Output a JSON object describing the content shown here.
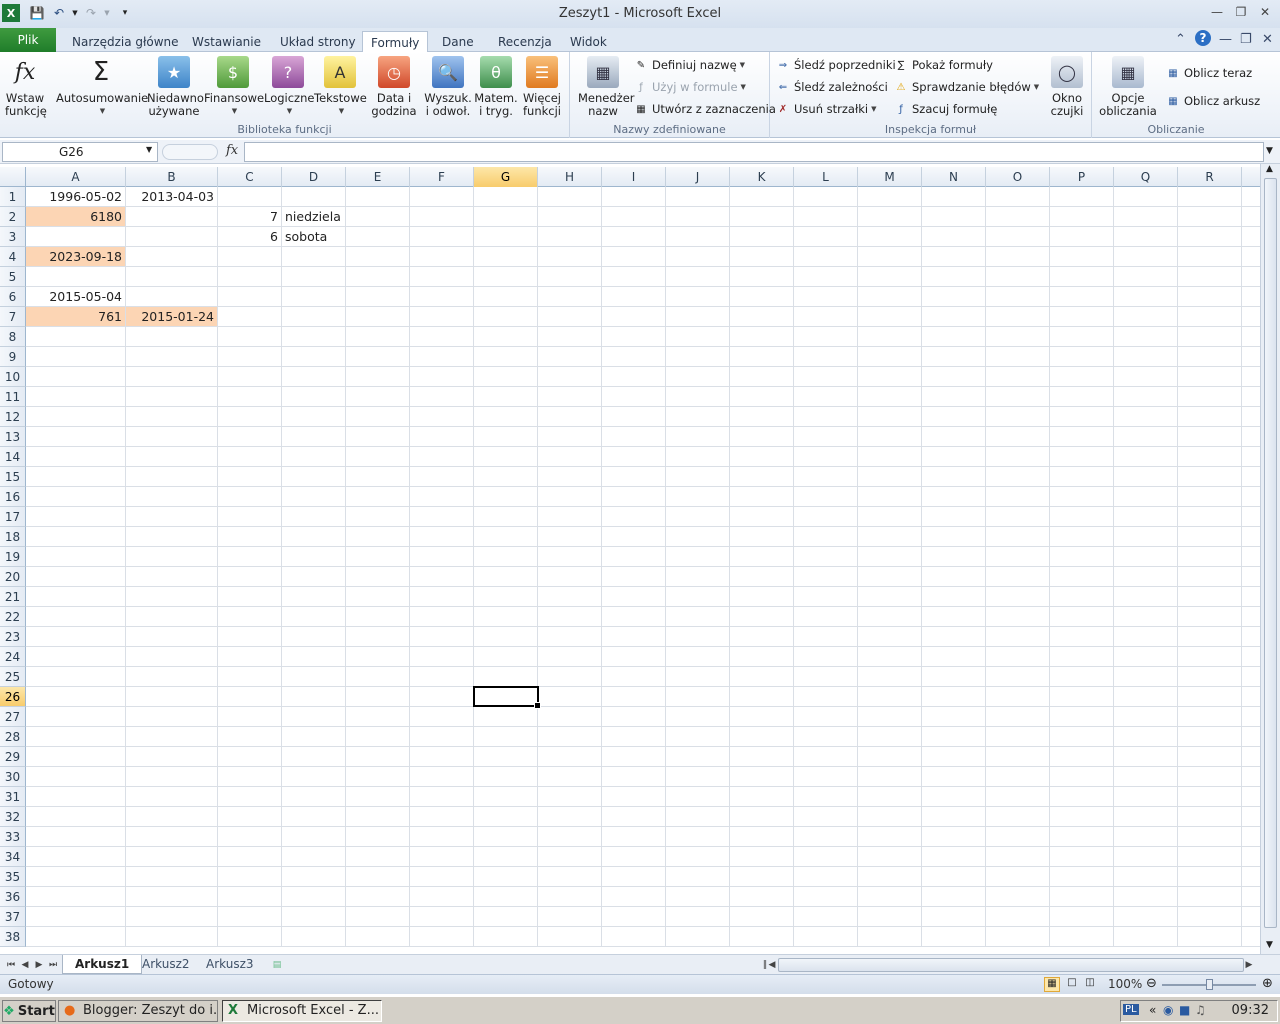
{
  "window": {
    "title": "Zeszyt1  -  Microsoft Excel"
  },
  "ribbon_tabs": [
    "Plik",
    "Narzędzia główne",
    "Wstawianie",
    "Układ strony",
    "Formuły",
    "Dane",
    "Recenzja",
    "Widok"
  ],
  "active_tab": "Formuły",
  "groups": {
    "biblioteka": {
      "label": "Biblioteka funkcji",
      "insert_function": "Wstaw funkcję",
      "autosum": "Autosumowanie",
      "recent": "Niedawno używane",
      "financial": "Finansowe",
      "logical": "Logiczne",
      "text": "Tekstowe",
      "datetime": "Data i godzina",
      "lookup": "Wyszuk. i odwoł.",
      "math": "Matem. i tryg.",
      "more": "Więcej funkcji"
    },
    "nazwy": {
      "label": "Nazwy zdefiniowane",
      "manager": "Menedżer nazw",
      "define": "Definiuj nazwę",
      "use": "Użyj w formule",
      "create": "Utwórz z zaznaczenia"
    },
    "inspekcja": {
      "label": "Inspekcja formuł",
      "precedents": "Śledź poprzedniki",
      "dependents": "Śledź zależności",
      "remove": "Usuń strzałki",
      "show": "Pokaż formuły",
      "errors": "Sprawdzanie błędów",
      "evaluate": "Szacuj formułę",
      "watch": "Okno czujki"
    },
    "obliczanie": {
      "label": "Obliczanie",
      "options": "Opcje obliczania",
      "calc_now": "Oblicz teraz",
      "calc_sheet": "Oblicz arkusz"
    }
  },
  "formula_bar": {
    "name_box": "G26",
    "fx": "fx",
    "value": ""
  },
  "columns": [
    "A",
    "B",
    "C",
    "D",
    "E",
    "F",
    "G",
    "H",
    "I",
    "J",
    "K",
    "L",
    "M",
    "N",
    "O",
    "P",
    "Q",
    "R"
  ],
  "selected_column": "G",
  "rows": [
    "1",
    "2",
    "3",
    "4",
    "5",
    "6",
    "7",
    "8",
    "9",
    "10",
    "11",
    "12",
    "13",
    "14",
    "15",
    "16",
    "17",
    "18",
    "19",
    "20",
    "21",
    "22",
    "23",
    "24",
    "25",
    "26",
    "27",
    "28",
    "29",
    "30",
    "31",
    "32",
    "33",
    "34",
    "35",
    "36",
    "37",
    "38"
  ],
  "selected_row": "26",
  "cells": [
    {
      "ref": "A1",
      "value": "1996-05-02",
      "highlight": false
    },
    {
      "ref": "B1",
      "value": "2013-04-03",
      "highlight": false
    },
    {
      "ref": "A2",
      "value": "6180",
      "highlight": true
    },
    {
      "ref": "C2",
      "value": "7",
      "highlight": false
    },
    {
      "ref": "D2",
      "value": "niedziela",
      "highlight": false,
      "align": "left"
    },
    {
      "ref": "C3",
      "value": "6",
      "highlight": false
    },
    {
      "ref": "D3",
      "value": "sobota",
      "highlight": false,
      "align": "left"
    },
    {
      "ref": "A4",
      "value": "2023-09-18",
      "highlight": true
    },
    {
      "ref": "A6",
      "value": "2015-05-04",
      "highlight": false
    },
    {
      "ref": "A7",
      "value": "761",
      "highlight": true
    },
    {
      "ref": "B7",
      "value": "2015-01-24",
      "highlight": true
    }
  ],
  "highlight_color": "#fcd5b4",
  "sheets": [
    "Arkusz1",
    "Arkusz2",
    "Arkusz3"
  ],
  "active_sheet": "Arkusz1",
  "status": {
    "text": "Gotowy",
    "zoom": "100%"
  },
  "taskbar": {
    "start": "Start",
    "items": [
      "Blogger: Zeszyt do i...",
      "Microsoft Excel - Z..."
    ],
    "lang": "PL",
    "clock": "09:32"
  }
}
